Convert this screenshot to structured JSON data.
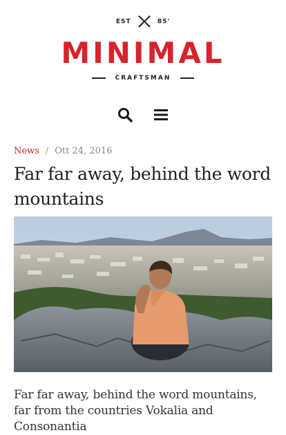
{
  "brand": {
    "top_left": "EST",
    "top_right": "85'",
    "name": "MINIMAL",
    "tagline": "CRAFTSMAN",
    "accent_color": "#d8232a"
  },
  "nav": {
    "search_icon": "search-icon",
    "menu_icon": "menu-icon"
  },
  "post": {
    "category": "News",
    "separator": "/",
    "date": "Ott 24, 2016",
    "title": "Far far away, behind the word mountains",
    "image_alt": "man-sitting-on-rock-overlooking-city",
    "excerpt": "Far far away, behind the word mountains, far from the countries Vokalia and Consonantia"
  }
}
